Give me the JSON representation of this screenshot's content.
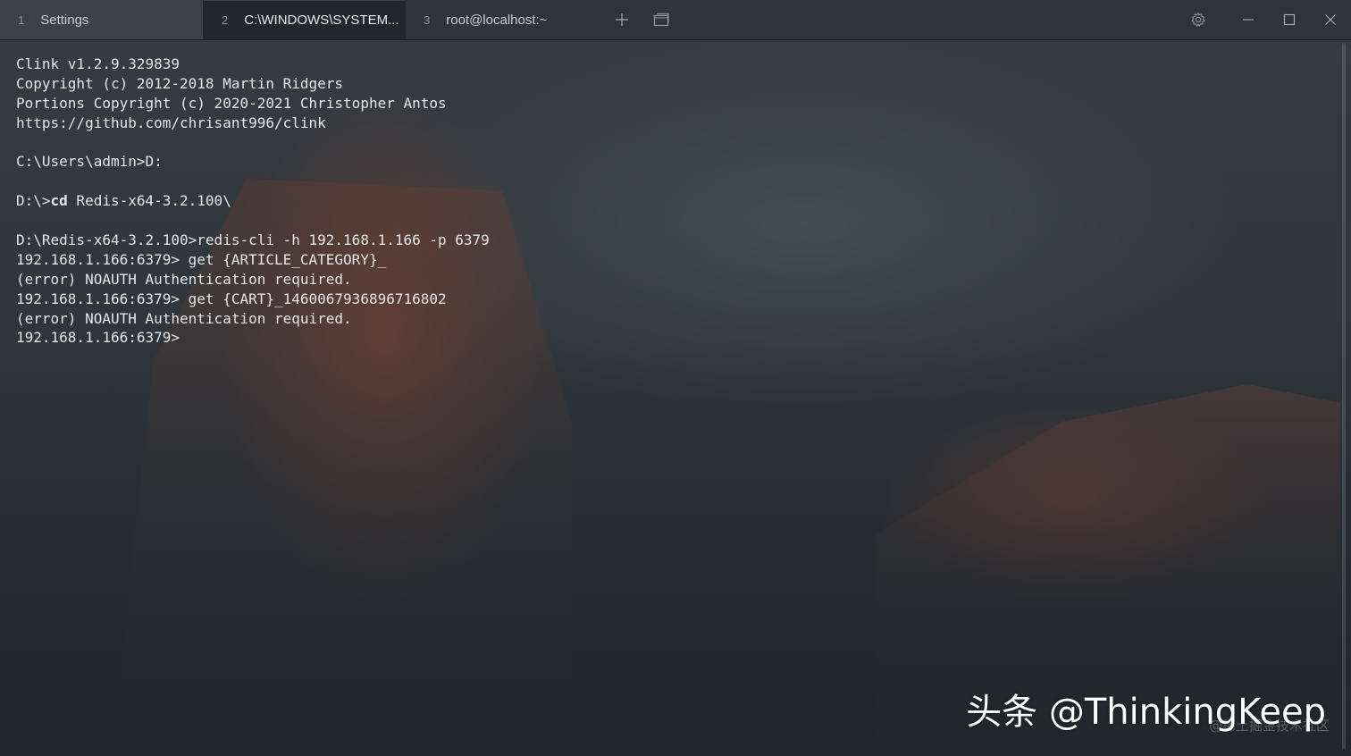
{
  "tabs": [
    {
      "number": "1",
      "label": "Settings",
      "active": false
    },
    {
      "number": "2",
      "label": "C:\\WINDOWS\\SYSTEM...",
      "active": true
    },
    {
      "number": "3",
      "label": "root@localhost:~",
      "active": false
    }
  ],
  "toolbar": {
    "new_tab_icon": "plus-icon",
    "tab_switcher_icon": "window-stack-icon",
    "settings_icon": "gear-icon"
  },
  "window_controls": {
    "minimize_icon": "minimize-icon",
    "maximize_icon": "maximize-icon",
    "close_icon": "close-icon"
  },
  "terminal": {
    "lines": [
      {
        "prefix": "Clink v1.2.9.329839",
        "cmd": "",
        "rest": ""
      },
      {
        "prefix": "Copyright (c) 2012-2018 Martin Ridgers",
        "cmd": "",
        "rest": ""
      },
      {
        "prefix": "Portions Copyright (c) 2020-2021 Christopher Antos",
        "cmd": "",
        "rest": ""
      },
      {
        "prefix": "https://github.com/chrisant996/clink",
        "cmd": "",
        "rest": ""
      },
      {
        "prefix": "",
        "cmd": "",
        "rest": ""
      },
      {
        "prefix": "C:\\Users\\admin>D:",
        "cmd": "",
        "rest": ""
      },
      {
        "prefix": "",
        "cmd": "",
        "rest": ""
      },
      {
        "prefix": "D:\\>",
        "cmd": "cd",
        "rest": " Redis-x64-3.2.100\\"
      },
      {
        "prefix": "",
        "cmd": "",
        "rest": ""
      },
      {
        "prefix": "D:\\Redis-x64-3.2.100>redis-cli -h 192.168.1.166 -p 6379",
        "cmd": "",
        "rest": ""
      },
      {
        "prefix": "192.168.1.166:6379> get {ARTICLE_CATEGORY}_",
        "cmd": "",
        "rest": ""
      },
      {
        "prefix": "(error) NOAUTH Authentication required.",
        "cmd": "",
        "rest": ""
      },
      {
        "prefix": "192.168.1.166:6379> get {CART}_1460067936896716802",
        "cmd": "",
        "rest": ""
      },
      {
        "prefix": "(error) NOAUTH Authentication required.",
        "cmd": "",
        "rest": ""
      },
      {
        "prefix": "192.168.1.166:6379>",
        "cmd": "",
        "rest": ""
      }
    ]
  },
  "watermark": {
    "main": "头条 @ThinkingKeep",
    "sub": "@稀土掘金技术社区"
  },
  "colors": {
    "tabbar_bg": "#2e3439",
    "active_tab_bg": "#23272b",
    "terminal_text": "#e6e6e6"
  }
}
